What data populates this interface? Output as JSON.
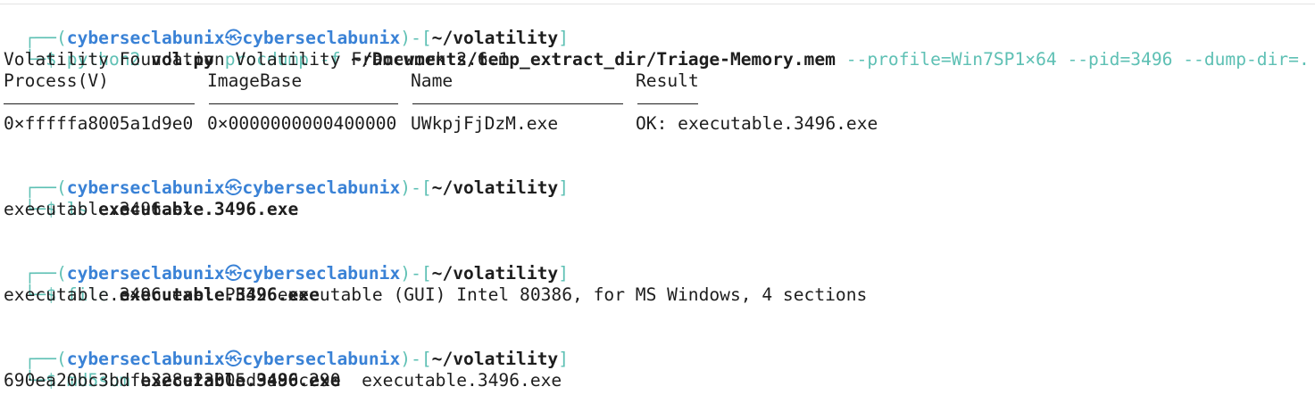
{
  "prompt": {
    "user": "cyberseclabunix",
    "host": "cyberseclabunix",
    "cwd": "~/volatility",
    "separator": "㉿",
    "corner_top": "┌──(",
    "mid": ")-[",
    "end": "]",
    "corner_bottom": "└─$"
  },
  "commands": [
    {
      "cmd": "python2",
      "args_bold1": "vol.py",
      "args_plain1": "procdump",
      "args_opt1": "-f",
      "args_bold2": "~/Documents/temp_extract_dir/Triage-Memory.mem",
      "args_opt2": "--profile=Win7SP1×64 --pid=3496 --dump-dir=."
    },
    {
      "cmd": "ls",
      "arg": "executable.3496.exe"
    },
    {
      "cmd": "file",
      "arg": "executable.3496.exe"
    },
    {
      "cmd": "md5sum",
      "arg": "executable.3496.exe"
    }
  ],
  "output": {
    "volatility_banner": "Volatility Foundation Volatility Framework 2.6.1",
    "table": {
      "headers": [
        "Process(V)",
        "ImageBase",
        "Name",
        "Result"
      ],
      "rows": [
        [
          "0×fffffa8005a1d9e0",
          "0×0000000000400000",
          "UWkpjFjDzM.exe",
          "OK: executable.3496.exe"
        ]
      ]
    },
    "ls_result": "executable.3496.exe",
    "file_result": "executable.3496.exe: PE32 executable (GUI) Intel 80386, for MS Windows, 4 sections",
    "md5_result": "690ea20bc3bdfb328e23005d9a80c290  executable.3496.exe"
  },
  "colors": {
    "prompt_frame": "#5ec0b4",
    "user_host": "#3a82d6",
    "text": "#1e1e1e",
    "background": "#ffffff"
  }
}
